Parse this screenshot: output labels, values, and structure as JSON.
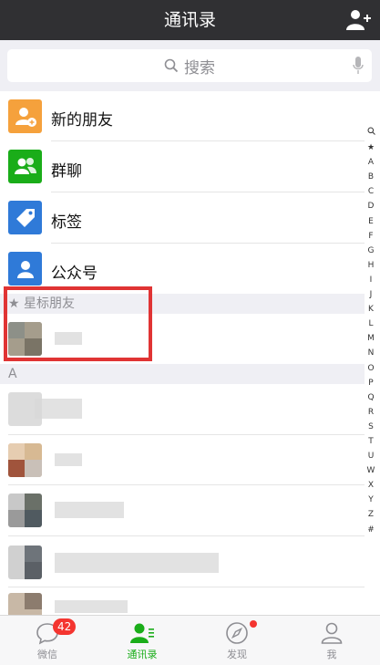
{
  "header": {
    "title": "通讯录"
  },
  "search": {
    "placeholder": "搜索"
  },
  "functions": [
    {
      "label": "新的朋友",
      "color": "#f5a13c",
      "icon": "new-friend-icon"
    },
    {
      "label": "群聊",
      "color": "#1aad19",
      "icon": "group-chat-icon"
    },
    {
      "label": "标签",
      "color": "#2f7ad8",
      "icon": "tag-icon"
    },
    {
      "label": "公众号",
      "color": "#2f7ad8",
      "icon": "official-account-icon"
    }
  ],
  "sections": {
    "starred": "★ 星标朋友",
    "a": "A"
  },
  "index": [
    "Q",
    "★",
    "A",
    "B",
    "C",
    "D",
    "E",
    "F",
    "G",
    "H",
    "I",
    "J",
    "K",
    "L",
    "M",
    "N",
    "O",
    "P",
    "Q",
    "R",
    "S",
    "T",
    "U",
    "W",
    "X",
    "Y",
    "Z",
    "#"
  ],
  "tabs": [
    {
      "label": "微信",
      "badge": "42",
      "icon": "chat-bubble-icon"
    },
    {
      "label": "通讯录",
      "icon": "contacts-icon"
    },
    {
      "label": "发现",
      "icon": "compass-icon"
    },
    {
      "label": "我",
      "icon": "person-icon"
    }
  ],
  "colors": {
    "accent": "#1aad19",
    "highlight_box": "#e03434",
    "badge": "#f43530",
    "topbar": "#303033"
  }
}
